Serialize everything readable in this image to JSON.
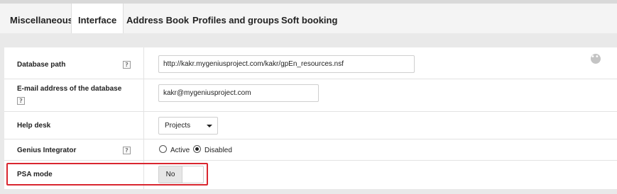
{
  "tabs": [
    {
      "label": "Miscellaneous",
      "active": false
    },
    {
      "label": "Interface",
      "active": true
    },
    {
      "label": "Address Book",
      "active": false
    },
    {
      "label": "Profiles and groups",
      "active": false
    },
    {
      "label": "Soft booking",
      "active": false
    }
  ],
  "form": {
    "more_icon": "more-horizontal-icon",
    "help_glyph": "?",
    "database_path": {
      "label": "Database path",
      "value": "http://kakr.mygeniusproject.com/kakr/gpEn_resources.nsf"
    },
    "email_db": {
      "label": "E-mail address of the database",
      "value": "kakr@mygeniusproject.com"
    },
    "help_desk": {
      "label": "Help desk",
      "selected": "Projects"
    },
    "genius_integrator": {
      "label": "Genius Integrator",
      "options": [
        {
          "label": "Active",
          "checked": false
        },
        {
          "label": "Disabled",
          "checked": true
        }
      ]
    },
    "psa_mode": {
      "label": "PSA mode",
      "value": "No",
      "highlighted": true
    }
  },
  "colors": {
    "highlight": "#d9262f",
    "panel": "#ffffff",
    "background": "#e9e9e9"
  }
}
